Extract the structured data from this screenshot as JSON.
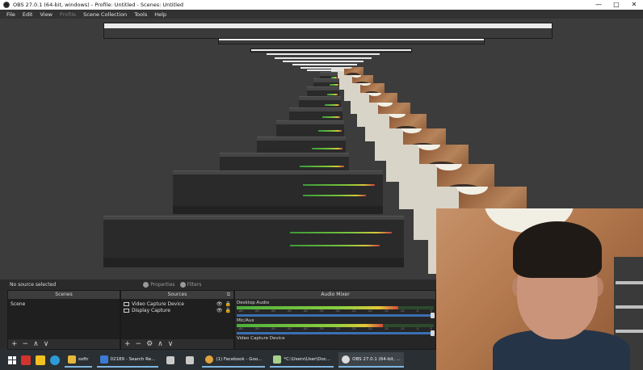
{
  "window": {
    "title": "OBS 27.0.1 (64-bit, windows) - Profile: Untitled - Scenes: Untitled",
    "controls": [
      "—",
      "□",
      "✕"
    ]
  },
  "menu": {
    "items": [
      "File",
      "Edit",
      "View",
      "Profile",
      "Scene Collection",
      "Tools",
      "Help"
    ]
  },
  "status": {
    "no_source": "No source selected",
    "properties_label": "Properties",
    "filters_label": "Filters"
  },
  "scenes_dock": {
    "title": "Scenes",
    "items": [
      "Scene"
    ],
    "footer": [
      "+",
      "−",
      "∧",
      "∨"
    ]
  },
  "sources_dock": {
    "title": "Sources",
    "items": [
      "Video Capture Device",
      "Display Capture"
    ],
    "footer": [
      "+",
      "−",
      "⚙",
      "∧",
      "∨"
    ]
  },
  "mixer": {
    "title": "Audio Mixer",
    "channels": [
      {
        "name": "Desktop Audio",
        "level": 0.82
      },
      {
        "name": "Mic/Aux",
        "level": 0.74
      },
      {
        "name": "Video Capture Device",
        "level": 0
      }
    ],
    "ticks": [
      "-60",
      "-55",
      "-50",
      "-45",
      "-40",
      "-35",
      "-30",
      "-25",
      "-20",
      "-15",
      "-10",
      "-5",
      "0"
    ]
  },
  "taskbar": {
    "items": [
      {
        "label": "softr",
        "icon": "folder-icon",
        "color": "#e5b73b"
      },
      {
        "label": "02189 - Search Re...",
        "icon": "document-icon",
        "color": "#3b7bd6"
      },
      {
        "label": "",
        "icon": "tool-icon",
        "color": "#c9c9c9"
      },
      {
        "label": "",
        "icon": "app-icon",
        "color": "#c9c9c9"
      },
      {
        "label": "(1) Facebook - Goo...",
        "icon": "chrome-icon",
        "color": "#e0a23b"
      },
      {
        "label": "*C:\\Users\\User\\Doc...",
        "icon": "notepad-icon",
        "color": "#a8d08d"
      },
      {
        "label": "OBS 27.0.1 (64-bit, ...",
        "icon": "obs-icon",
        "color": "#dcdcdc"
      }
    ],
    "pinned": [
      {
        "icon": "bug-icon",
        "color": "#d0342c"
      },
      {
        "icon": "lightning-icon",
        "color": "#f2c11f"
      },
      {
        "icon": "edge-icon",
        "color": "#2d9bd8"
      }
    ]
  }
}
